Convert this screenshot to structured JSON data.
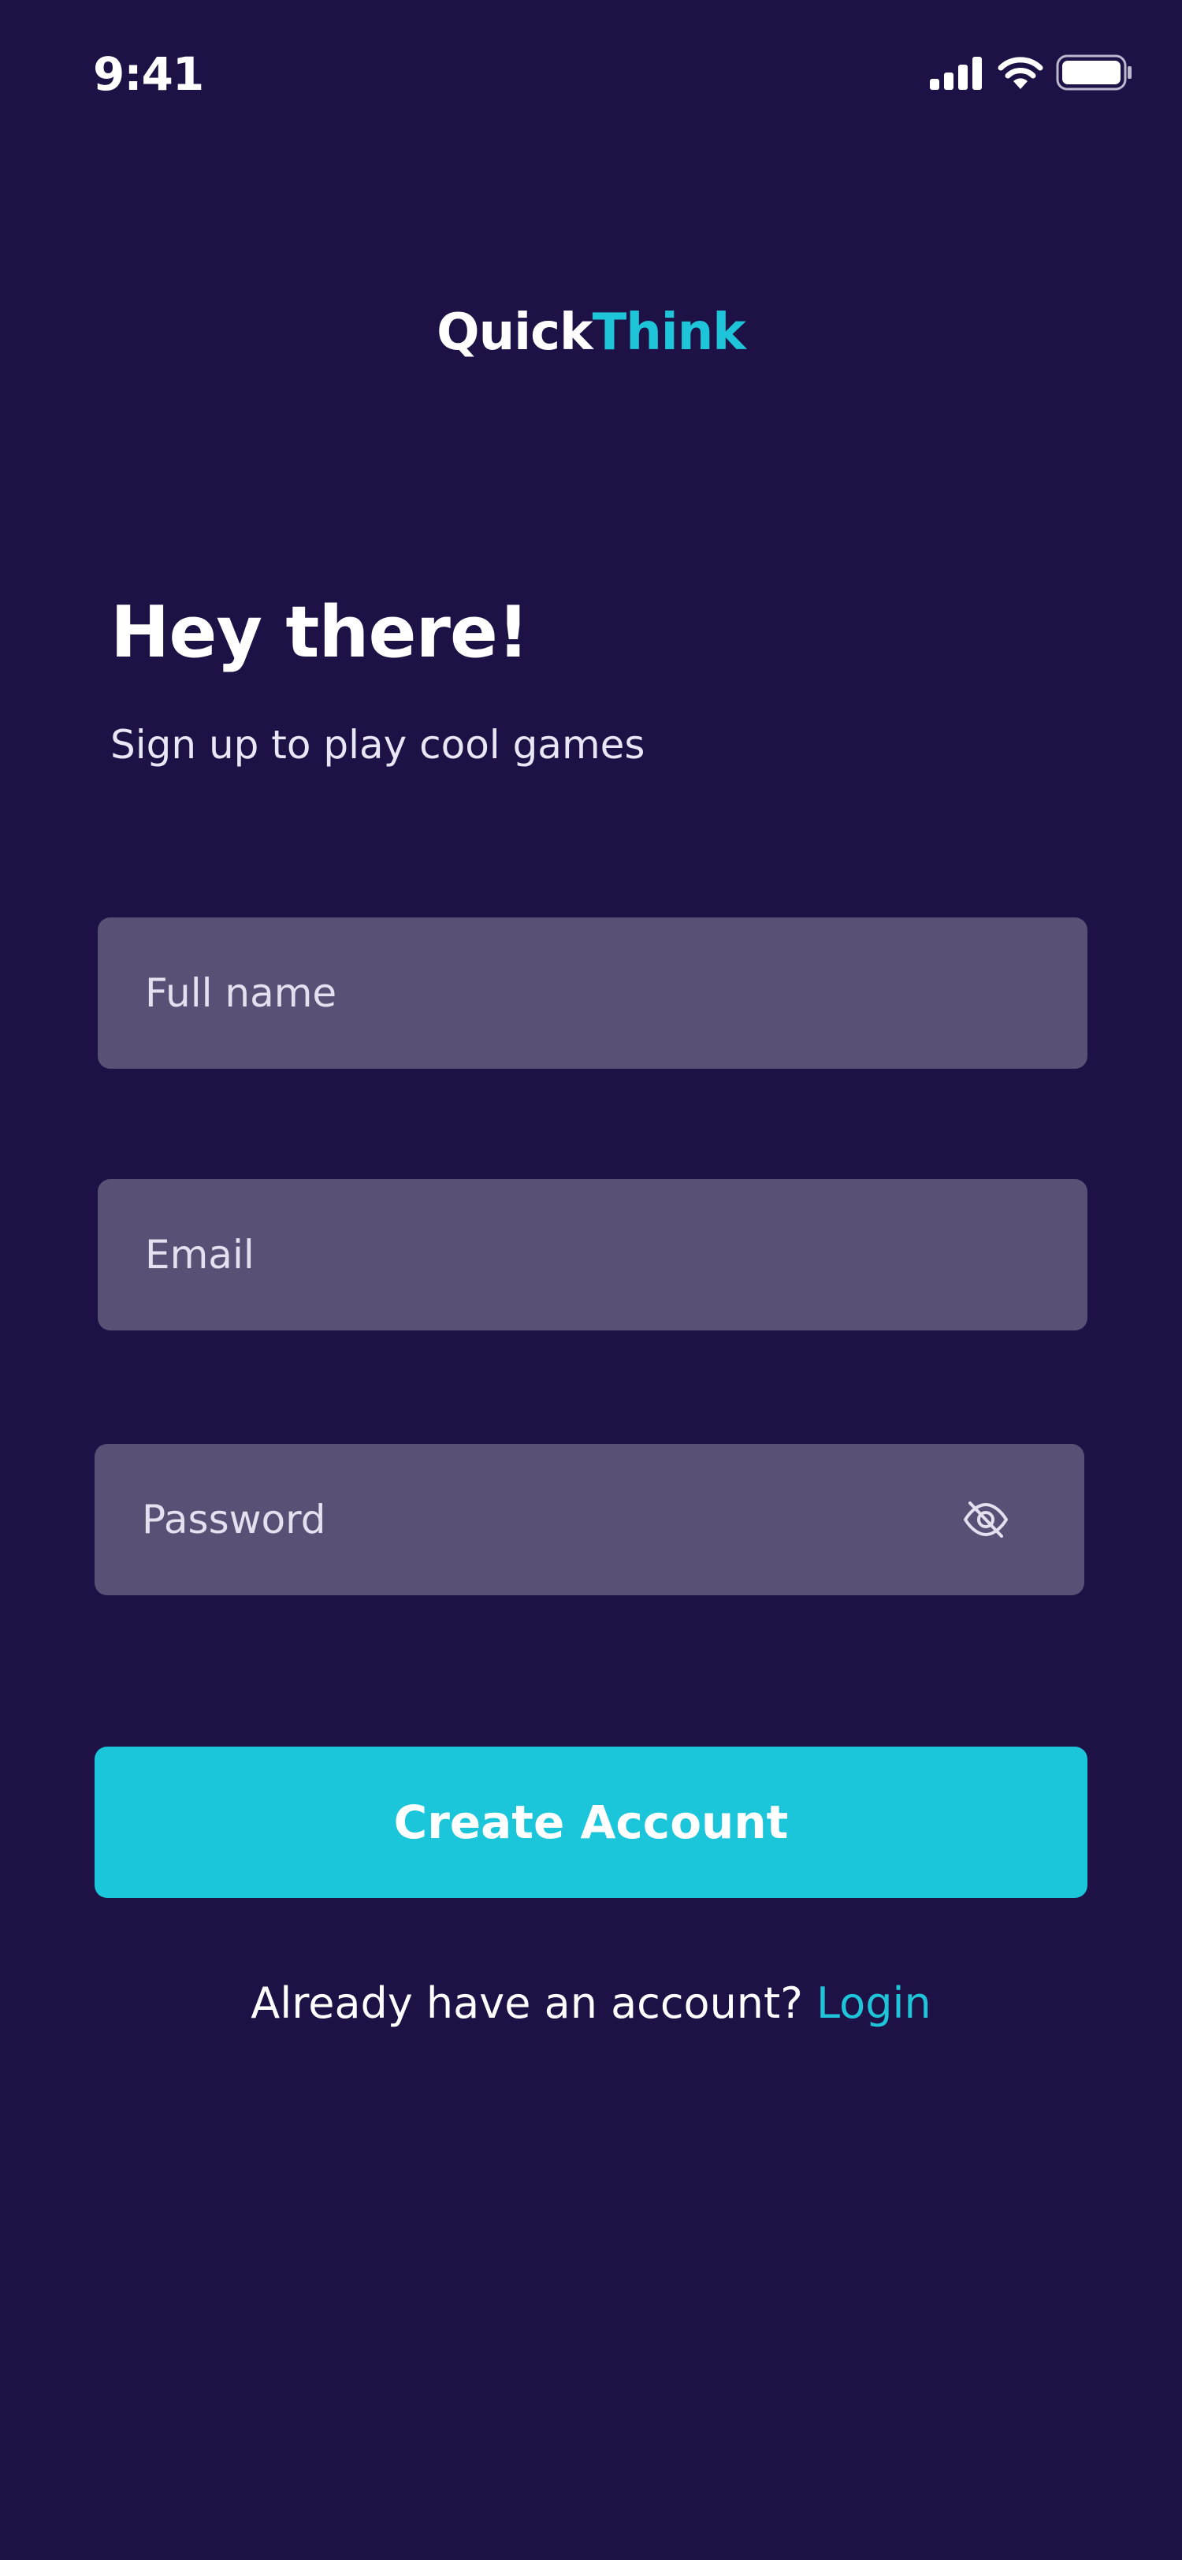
{
  "status_bar": {
    "time": "9:41",
    "icons": [
      "cellular-signal-icon",
      "wifi-icon",
      "battery-icon"
    ]
  },
  "logo": {
    "part1": "Quick",
    "part2": "Think"
  },
  "header": {
    "title": "Hey there!",
    "subtitle": "Sign up to play cool games"
  },
  "form": {
    "full_name": {
      "placeholder": "Full name",
      "value": ""
    },
    "email": {
      "placeholder": "Email",
      "value": ""
    },
    "password": {
      "placeholder": "Password",
      "value": "",
      "toggle_icon": "eye-off-icon"
    },
    "submit_label": "Create Account"
  },
  "footer": {
    "prompt": "Already have an account? ",
    "link_label": "Login"
  },
  "colors": {
    "background": "#1d1145",
    "field": "#595175",
    "accent": "#1cc6da",
    "text": "#ffffff"
  }
}
